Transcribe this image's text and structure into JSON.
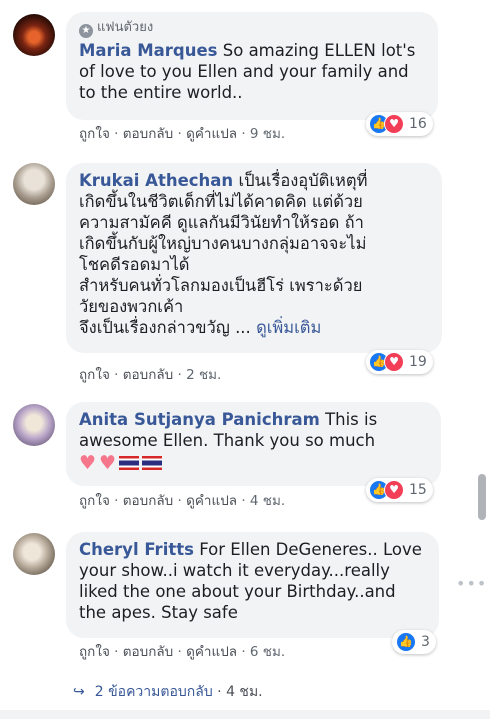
{
  "comments": [
    {
      "fan_badge": "แฟนตัวยง",
      "name": "Maria Marques",
      "text": "So amazing ELLEN lot's of love to you Ellen and your family and to the entire world..",
      "actions": {
        "like": "ถูกใจ",
        "reply": "ตอบกลับ",
        "translate": "ดูคำแปล",
        "time": "9 ชม."
      },
      "reaction_count": "16",
      "avatar_color": "#3a1a10"
    },
    {
      "name": "Krukai Athechan",
      "text_lines": [
        "เป็นเรื่องอุบัติเหตุที่",
        "เกิดขึ้นในชีวิตเด็กที่ไม่ได้คาดคิด แต่ด้วย",
        "ความสามัคคี ดูแลกันมีวินัยทำให้รอด ถ้า",
        "เกิดขึ้นกับผู้ใหญ่บางคนบางกลุ่มอาจจะไม่",
        "โชคดีรอดมาได้",
        "สำหรับคนทั่วโลกมองเป็นฮีโร่ เพราะด้วย",
        "วัยของพวกเค้า",
        "จึงเป็นเรื่องกล่าวขวัญ ..."
      ],
      "see_more": "ดูเพิ่มเติม",
      "actions": {
        "like": "ถูกใจ",
        "reply": "ตอบกลับ",
        "time": "2 ชม."
      },
      "reaction_count": "19",
      "avatar_color": "#c9c2b8"
    },
    {
      "name": "Anita Sutjanya Panichram",
      "text": "This is awesome Ellen. Thank you so much",
      "emoji": [
        "heart",
        "heart",
        "flag-thailand",
        "flag-thailand"
      ],
      "actions": {
        "like": "ถูกใจ",
        "reply": "ตอบกลับ",
        "translate": "ดูคำแปล",
        "time": "4 ชม."
      },
      "reaction_count": "15",
      "avatar_color": "#b9a6c9"
    },
    {
      "name": "Cheryl Fritts",
      "text": "For Ellen DeGeneres.. Love your show..i watch it everyday...really liked the one about your Birthday..and the apes. Stay safe",
      "actions": {
        "like": "ถูกใจ",
        "reply": "ตอบกลับ",
        "translate": "ดูคำแปล",
        "time": "6 ชม."
      },
      "reaction_count": "3",
      "avatar_color": "#9a8f83"
    }
  ],
  "replies_link": {
    "label": "2 ข้อความตอบกลับ",
    "time": "4 ชม."
  },
  "separator": "·",
  "colors": {
    "name_blue": "#385898",
    "bubble_bg": "#f2f3f5",
    "like_blue": "#1877f2",
    "love_red": "#f33e58",
    "meta_gray": "#606770"
  },
  "icons": {
    "like": "thumbs-up-icon",
    "love": "heart-icon",
    "reply_arrow": "reply-arrow-icon",
    "more": "more-options-icon",
    "fan_badge": "star-badge-icon"
  }
}
